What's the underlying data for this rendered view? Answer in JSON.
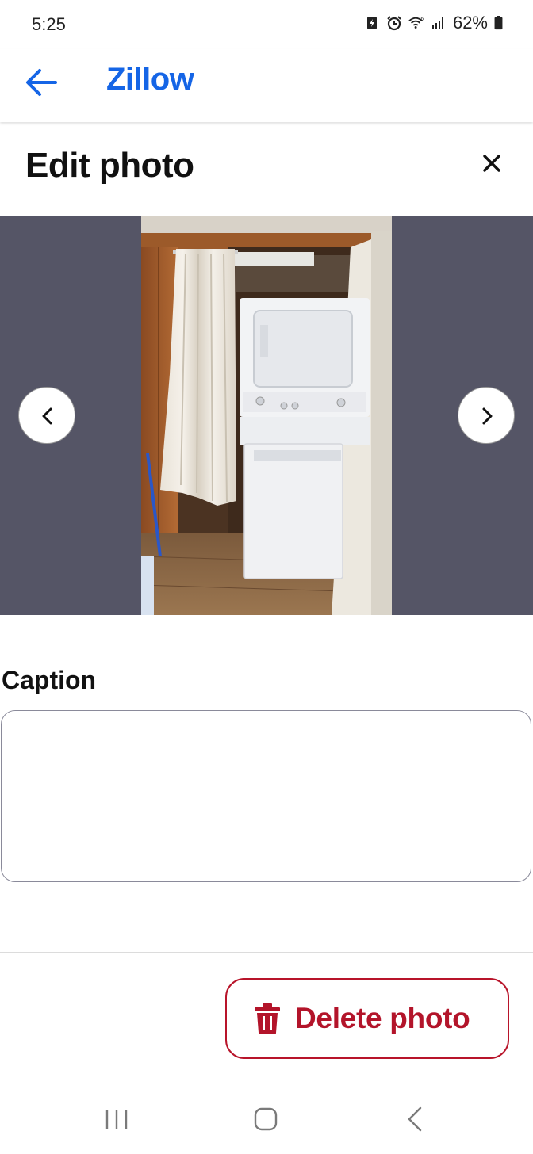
{
  "status_bar": {
    "time": "5:25",
    "battery": "62%",
    "icons": [
      "battery-saver-icon",
      "alarm-icon",
      "wifi-icon",
      "signal-icon",
      "battery-icon"
    ]
  },
  "app_bar": {
    "title": "Zillow",
    "title_color": "#1565e6",
    "back_icon": "arrow-left-icon"
  },
  "sheet": {
    "title": "Edit photo",
    "close_icon": "close-icon"
  },
  "gallery": {
    "background_color": "#555566",
    "prev_icon": "chevron-left-icon",
    "next_icon": "chevron-right-icon"
  },
  "caption": {
    "label": "Caption",
    "value": "",
    "placeholder": ""
  },
  "actions": {
    "delete_label": "Delete photo",
    "delete_color": "#b3142a",
    "delete_icon": "trash-icon"
  },
  "system_nav": {
    "items": [
      "recent-apps-icon",
      "home-icon",
      "back-icon"
    ]
  }
}
